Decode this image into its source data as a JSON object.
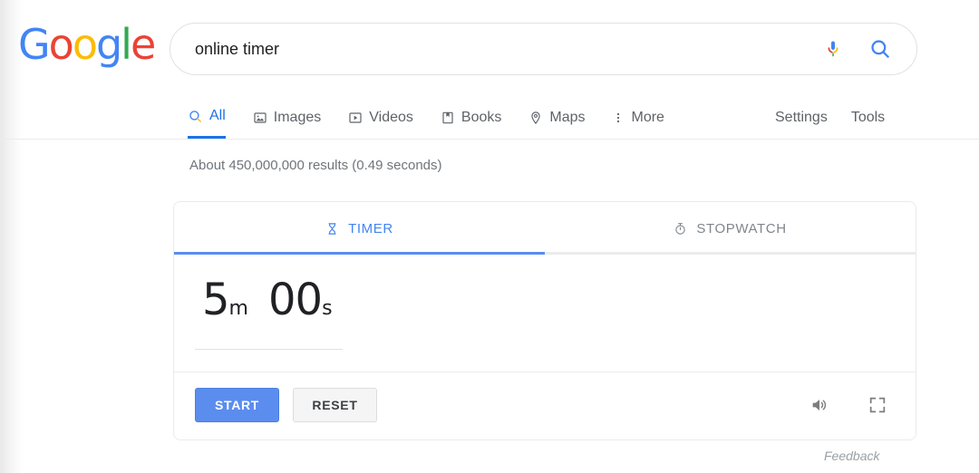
{
  "brand": {
    "name": "Google",
    "letters": [
      {
        "ch": "G",
        "color": "#4285f4"
      },
      {
        "ch": "o",
        "color": "#ea4335"
      },
      {
        "ch": "o",
        "color": "#fbbc05"
      },
      {
        "ch": "g",
        "color": "#4285f4"
      },
      {
        "ch": "l",
        "color": "#34a853"
      },
      {
        "ch": "e",
        "color": "#ea4335"
      }
    ]
  },
  "search": {
    "query": "online timer",
    "placeholder": "Search",
    "mic_icon": "microphone-icon",
    "search_icon": "search-icon"
  },
  "nav": {
    "items": [
      {
        "label": "All",
        "icon": "search-icon",
        "active": true
      },
      {
        "label": "Images",
        "icon": "image-icon",
        "active": false
      },
      {
        "label": "Videos",
        "icon": "video-icon",
        "active": false
      },
      {
        "label": "Books",
        "icon": "book-icon",
        "active": false
      },
      {
        "label": "Maps",
        "icon": "map-pin-icon",
        "active": false
      },
      {
        "label": "More",
        "icon": "more-vertical-icon",
        "active": false
      }
    ],
    "settings_label": "Settings",
    "tools_label": "Tools",
    "active_color": "#1a73e8",
    "inactive_color": "#5f6368"
  },
  "results": {
    "stats": "About 450,000,000 results (0.49 seconds)"
  },
  "timer_card": {
    "tabs": [
      {
        "label": "TIMER",
        "icon": "hourglass-icon",
        "active": true
      },
      {
        "label": "STOPWATCH",
        "icon": "stopwatch-icon",
        "active": false
      }
    ],
    "display": {
      "minutes": "5",
      "minutes_unit": "m",
      "seconds": "00",
      "seconds_unit": "s"
    },
    "buttons": {
      "start_label": "START",
      "reset_label": "RESET"
    },
    "icons": {
      "sound": "sound-on-icon",
      "fullscreen": "fullscreen-icon"
    },
    "accent_color": "#5b8def",
    "tab_active_color": "#4285f4"
  },
  "footer": {
    "feedback_label": "Feedback"
  }
}
